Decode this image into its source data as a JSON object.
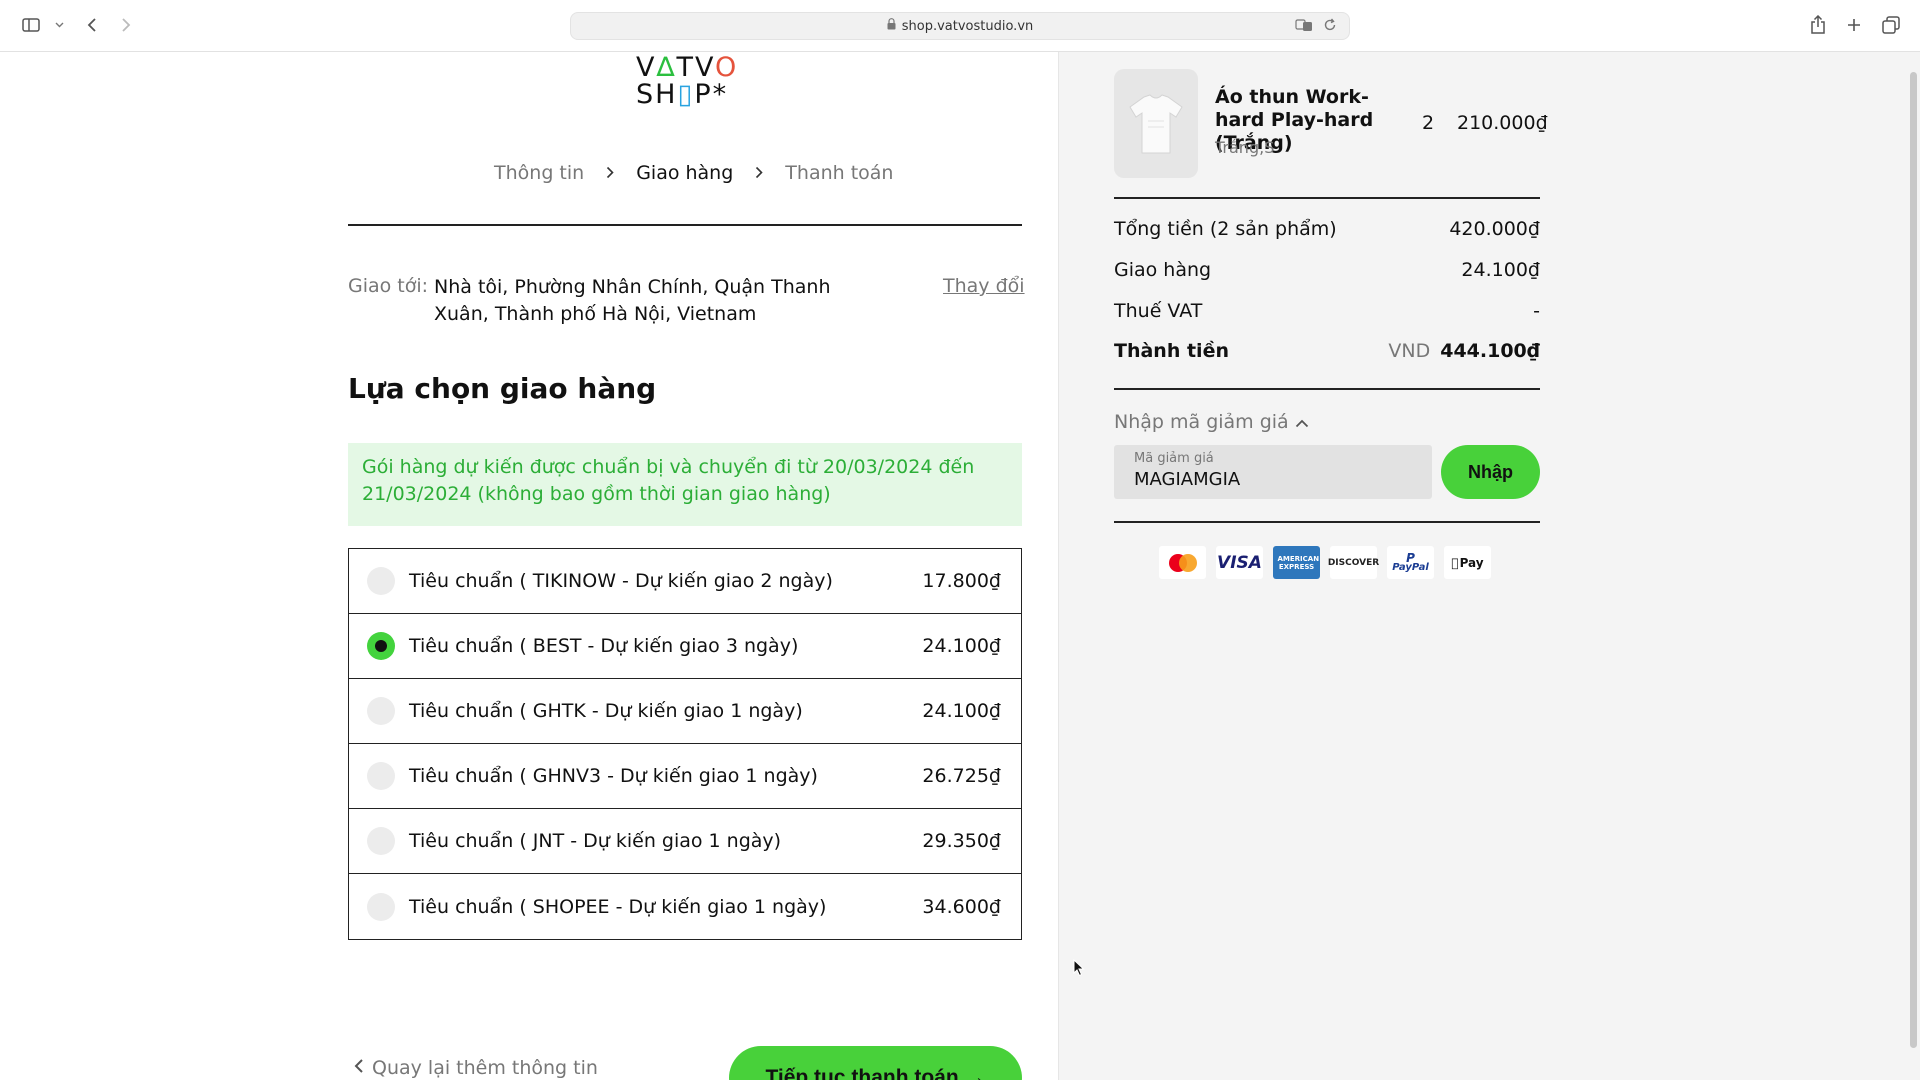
{
  "browser": {
    "url": "shop.vatvostudio.vn"
  },
  "logo": {
    "line1a": "V",
    "line1b": "∆",
    "line1c": "TV",
    "line1d": "O",
    "line2a": "SH",
    "line2b": "▯",
    "line2c": "P*"
  },
  "breadcrumb": {
    "items": [
      {
        "label": "Thông tin",
        "active": false
      },
      {
        "label": "Giao hàng",
        "active": true
      },
      {
        "label": "Thanh toán",
        "active": false
      }
    ]
  },
  "shipping": {
    "to_label": "Giao tới:",
    "address": "Nhà tôi, Phường Nhân Chính, Quận Thanh Xuân, Thành phố Hà Nội, Vietnam",
    "change_label": "Thay đổi",
    "section_title": "Lựa chọn giao hàng",
    "notice": "Gói hàng dự kiến được chuẩn bị và chuyển đi từ 20/03/2024 đến 21/03/2024 (không bao gồm thời gian giao hàng)",
    "options": [
      {
        "label": "Tiêu chuẩn ( TIKINOW - Dự kiến giao 2 ngày)",
        "price": "17.800₫",
        "selected": false
      },
      {
        "label": "Tiêu chuẩn ( BEST - Dự kiến giao 3 ngày)",
        "price": "24.100₫",
        "selected": true
      },
      {
        "label": "Tiêu chuẩn ( GHTK - Dự kiến giao 1 ngày)",
        "price": "24.100₫",
        "selected": false
      },
      {
        "label": "Tiêu chuẩn ( GHNV3 - Dự kiến giao 1 ngày)",
        "price": "26.725₫",
        "selected": false
      },
      {
        "label": "Tiêu chuẩn ( JNT - Dự kiến giao 1 ngày)",
        "price": "29.350₫",
        "selected": false
      },
      {
        "label": "Tiêu chuẩn ( SHOPEE - Dự kiến giao 1 ngày)",
        "price": "34.600₫",
        "selected": false
      }
    ],
    "back_label": "Quay lại thêm thông tin",
    "continue_label": "Tiếp tục thanh toán →"
  },
  "cart": {
    "product_name": "Áo thun Work-hard Play-hard (Trắng)",
    "variant": "Trắng,S",
    "qty": "2",
    "price": "210.000₫",
    "subtotal_label": "Tổng tiền (2 sản phẩm)",
    "subtotal_value": "420.000₫",
    "shipping_label": "Giao hàng",
    "shipping_value": "24.100₫",
    "vat_label": "Thuế VAT",
    "vat_value": "-",
    "total_label": "Thành tiền",
    "total_currency": "VND",
    "total_value": "444.100₫",
    "coupon_toggle": "Nhập mã giảm giá",
    "coupon_placeholder": "Mã giảm giá",
    "coupon_value": "MAGIAMGIA",
    "apply_label": "Nhập"
  },
  "payment_methods": [
    {
      "name": "mastercard-icon",
      "label": ""
    },
    {
      "name": "visa-icon",
      "label": "VISA"
    },
    {
      "name": "amex-icon",
      "label": "AMERICAN EXPRESS"
    },
    {
      "name": "discover-icon",
      "label": "DISCOVER"
    },
    {
      "name": "paypal-icon",
      "label": "PayPal"
    },
    {
      "name": "apple-pay-icon",
      "label": "Pay"
    }
  ],
  "colors": {
    "accent_green": "#48d13a",
    "notice_bg": "#e4f8e5",
    "notice_text": "#2cae37"
  }
}
